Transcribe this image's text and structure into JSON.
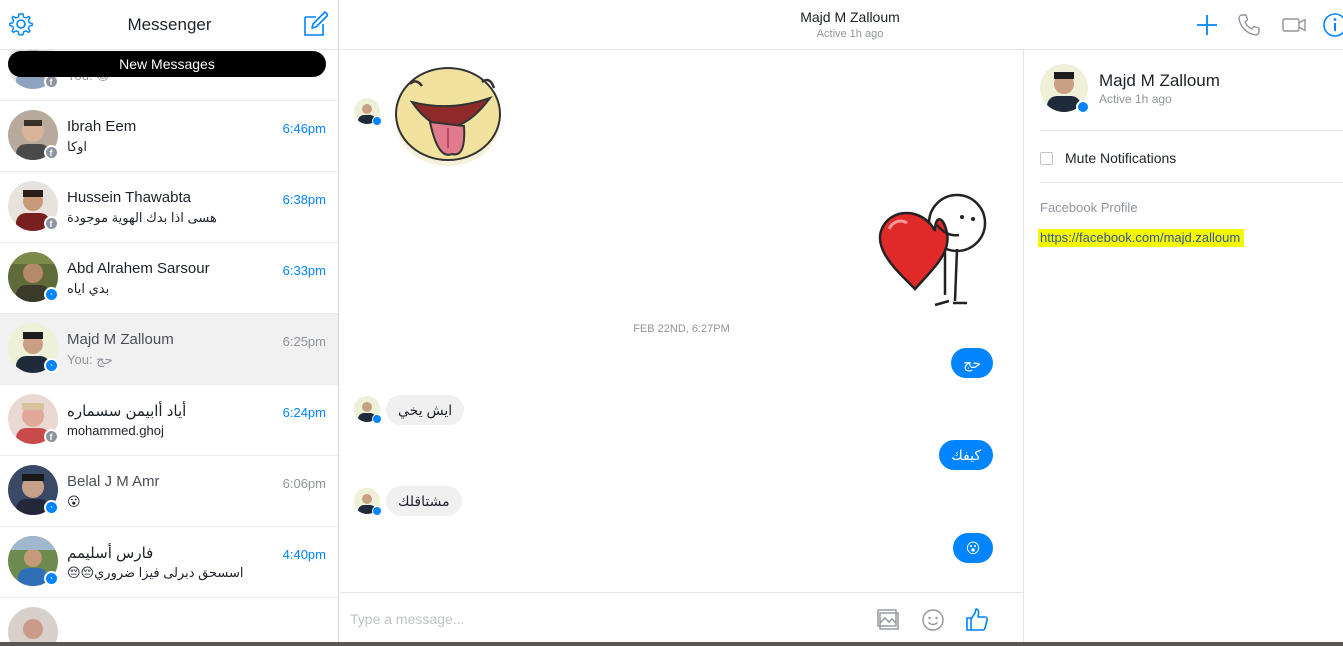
{
  "left": {
    "title": "Messenger",
    "new_messages": "New Messages",
    "top_partial_snippet": "You: 😉",
    "conversations": [
      {
        "name": "Ibrah Eem",
        "time": "6:46pm",
        "snippet": "اوكا",
        "badge": "fb",
        "unread": true
      },
      {
        "name": "Hussein Thawabta",
        "time": "6:38pm",
        "snippet": "هسى اذا بدك الهوية موجودة",
        "badge": "fb",
        "unread": true
      },
      {
        "name": "Abd Alrahem Sarsour",
        "time": "6:33pm",
        "snippet": "بدي اياه",
        "badge": "ms",
        "unread": true
      },
      {
        "name": "Majd M Zalloum",
        "time": "6:25pm",
        "snippet": "You: حج",
        "badge": "ms",
        "unread": false
      },
      {
        "name": "أياد أابيمن سسماره",
        "time": "6:24pm",
        "snippet": "mohammed.ghoj",
        "badge": "fb",
        "unread": true
      },
      {
        "name": "Belal J M Amr",
        "time": "6:06pm",
        "snippet": "😮",
        "badge": "ms",
        "unread": false
      },
      {
        "name": "فارس أسليمم",
        "time": "4:40pm",
        "snippet": "😔😔اسسحق دبرلى فيزا ضروري",
        "badge": "ms",
        "unread": true
      }
    ]
  },
  "header": {
    "name": "Majd M Zalloum",
    "status": "Active 1h ago"
  },
  "thread": {
    "date_divider": "FEB 22ND, 6:27PM",
    "messages": {
      "out1": "حج",
      "in1": "ايش يخي",
      "out2": "كيفك",
      "in2": "مشتاقلك",
      "out3": "😮"
    }
  },
  "composer": {
    "placeholder": "Type a message..."
  },
  "right": {
    "name": "Majd M Zalloum",
    "status": "Active 1h ago",
    "mute_label": "Mute Notifications",
    "fb_profile_label": "Facebook Profile",
    "fb_profile_url": "https://facebook.com/majd.zalloum"
  },
  "colors": {
    "accent": "#0084ff",
    "highlight": "#f3f800",
    "link": "#365899",
    "muted": "#90949c"
  },
  "icons": [
    "gear-icon",
    "compose-icon",
    "plus-icon",
    "phone-icon",
    "video-icon",
    "info-icon",
    "image-icon",
    "emoji-icon",
    "thumbs-up-icon"
  ]
}
